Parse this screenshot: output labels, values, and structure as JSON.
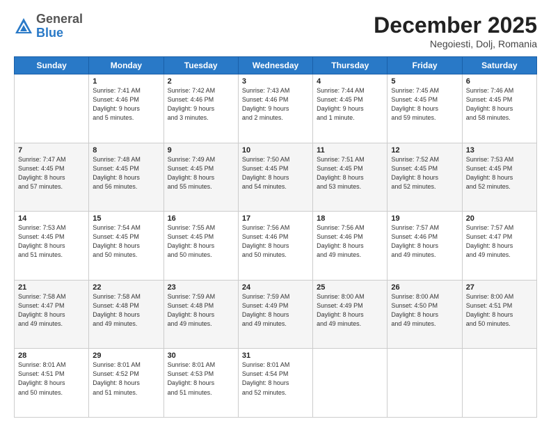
{
  "header": {
    "logo_general": "General",
    "logo_blue": "Blue",
    "month_title": "December 2025",
    "location": "Negoiesti, Dolj, Romania"
  },
  "weekdays": [
    "Sunday",
    "Monday",
    "Tuesday",
    "Wednesday",
    "Thursday",
    "Friday",
    "Saturday"
  ],
  "weeks": [
    [
      {
        "day": "",
        "info": ""
      },
      {
        "day": "1",
        "info": "Sunrise: 7:41 AM\nSunset: 4:46 PM\nDaylight: 9 hours\nand 5 minutes."
      },
      {
        "day": "2",
        "info": "Sunrise: 7:42 AM\nSunset: 4:46 PM\nDaylight: 9 hours\nand 3 minutes."
      },
      {
        "day": "3",
        "info": "Sunrise: 7:43 AM\nSunset: 4:46 PM\nDaylight: 9 hours\nand 2 minutes."
      },
      {
        "day": "4",
        "info": "Sunrise: 7:44 AM\nSunset: 4:45 PM\nDaylight: 9 hours\nand 1 minute."
      },
      {
        "day": "5",
        "info": "Sunrise: 7:45 AM\nSunset: 4:45 PM\nDaylight: 8 hours\nand 59 minutes."
      },
      {
        "day": "6",
        "info": "Sunrise: 7:46 AM\nSunset: 4:45 PM\nDaylight: 8 hours\nand 58 minutes."
      }
    ],
    [
      {
        "day": "7",
        "info": "Sunrise: 7:47 AM\nSunset: 4:45 PM\nDaylight: 8 hours\nand 57 minutes."
      },
      {
        "day": "8",
        "info": "Sunrise: 7:48 AM\nSunset: 4:45 PM\nDaylight: 8 hours\nand 56 minutes."
      },
      {
        "day": "9",
        "info": "Sunrise: 7:49 AM\nSunset: 4:45 PM\nDaylight: 8 hours\nand 55 minutes."
      },
      {
        "day": "10",
        "info": "Sunrise: 7:50 AM\nSunset: 4:45 PM\nDaylight: 8 hours\nand 54 minutes."
      },
      {
        "day": "11",
        "info": "Sunrise: 7:51 AM\nSunset: 4:45 PM\nDaylight: 8 hours\nand 53 minutes."
      },
      {
        "day": "12",
        "info": "Sunrise: 7:52 AM\nSunset: 4:45 PM\nDaylight: 8 hours\nand 52 minutes."
      },
      {
        "day": "13",
        "info": "Sunrise: 7:53 AM\nSunset: 4:45 PM\nDaylight: 8 hours\nand 52 minutes."
      }
    ],
    [
      {
        "day": "14",
        "info": "Sunrise: 7:53 AM\nSunset: 4:45 PM\nDaylight: 8 hours\nand 51 minutes."
      },
      {
        "day": "15",
        "info": "Sunrise: 7:54 AM\nSunset: 4:45 PM\nDaylight: 8 hours\nand 50 minutes."
      },
      {
        "day": "16",
        "info": "Sunrise: 7:55 AM\nSunset: 4:45 PM\nDaylight: 8 hours\nand 50 minutes."
      },
      {
        "day": "17",
        "info": "Sunrise: 7:56 AM\nSunset: 4:46 PM\nDaylight: 8 hours\nand 50 minutes."
      },
      {
        "day": "18",
        "info": "Sunrise: 7:56 AM\nSunset: 4:46 PM\nDaylight: 8 hours\nand 49 minutes."
      },
      {
        "day": "19",
        "info": "Sunrise: 7:57 AM\nSunset: 4:46 PM\nDaylight: 8 hours\nand 49 minutes."
      },
      {
        "day": "20",
        "info": "Sunrise: 7:57 AM\nSunset: 4:47 PM\nDaylight: 8 hours\nand 49 minutes."
      }
    ],
    [
      {
        "day": "21",
        "info": "Sunrise: 7:58 AM\nSunset: 4:47 PM\nDaylight: 8 hours\nand 49 minutes."
      },
      {
        "day": "22",
        "info": "Sunrise: 7:58 AM\nSunset: 4:48 PM\nDaylight: 8 hours\nand 49 minutes."
      },
      {
        "day": "23",
        "info": "Sunrise: 7:59 AM\nSunset: 4:48 PM\nDaylight: 8 hours\nand 49 minutes."
      },
      {
        "day": "24",
        "info": "Sunrise: 7:59 AM\nSunset: 4:49 PM\nDaylight: 8 hours\nand 49 minutes."
      },
      {
        "day": "25",
        "info": "Sunrise: 8:00 AM\nSunset: 4:49 PM\nDaylight: 8 hours\nand 49 minutes."
      },
      {
        "day": "26",
        "info": "Sunrise: 8:00 AM\nSunset: 4:50 PM\nDaylight: 8 hours\nand 49 minutes."
      },
      {
        "day": "27",
        "info": "Sunrise: 8:00 AM\nSunset: 4:51 PM\nDaylight: 8 hours\nand 50 minutes."
      }
    ],
    [
      {
        "day": "28",
        "info": "Sunrise: 8:01 AM\nSunset: 4:51 PM\nDaylight: 8 hours\nand 50 minutes."
      },
      {
        "day": "29",
        "info": "Sunrise: 8:01 AM\nSunset: 4:52 PM\nDaylight: 8 hours\nand 51 minutes."
      },
      {
        "day": "30",
        "info": "Sunrise: 8:01 AM\nSunset: 4:53 PM\nDaylight: 8 hours\nand 51 minutes."
      },
      {
        "day": "31",
        "info": "Sunrise: 8:01 AM\nSunset: 4:54 PM\nDaylight: 8 hours\nand 52 minutes."
      },
      {
        "day": "",
        "info": ""
      },
      {
        "day": "",
        "info": ""
      },
      {
        "day": "",
        "info": ""
      }
    ]
  ]
}
